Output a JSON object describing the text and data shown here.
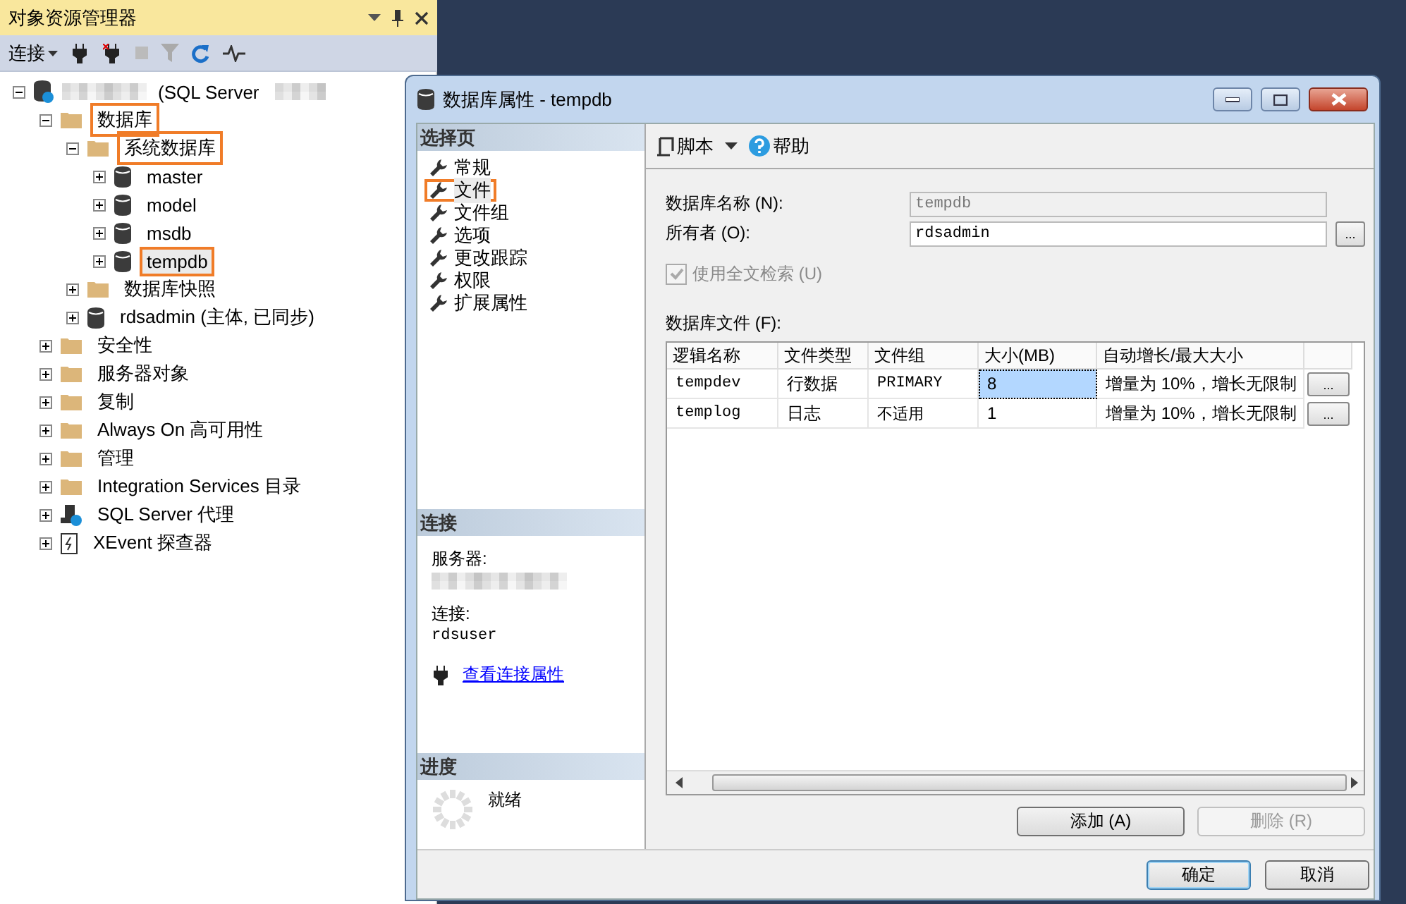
{
  "explorer": {
    "title": "对象资源管理器",
    "toolbar": {
      "connect": "连接"
    },
    "tree": [
      {
        "kind": "server",
        "label": "(SQL Server",
        "expanded": true,
        "selected": false,
        "annotated": false,
        "children": [
          {
            "kind": "folder",
            "label": "数据库",
            "expanded": true,
            "selected": false,
            "annotated": true,
            "children": [
              {
                "kind": "folder",
                "label": "系统数据库",
                "expanded": true,
                "selected": false,
                "annotated": true,
                "children": [
                  {
                    "kind": "database",
                    "label": "master",
                    "expanded": false,
                    "selected": false,
                    "annotated": false
                  },
                  {
                    "kind": "database",
                    "label": "model",
                    "expanded": false,
                    "selected": false,
                    "annotated": false
                  },
                  {
                    "kind": "database",
                    "label": "msdb",
                    "expanded": false,
                    "selected": false,
                    "annotated": false
                  },
                  {
                    "kind": "database",
                    "label": "tempdb",
                    "expanded": false,
                    "selected": true,
                    "annotated": true
                  }
                ]
              },
              {
                "kind": "folder",
                "label": "数据库快照",
                "expanded": false,
                "selected": false,
                "annotated": false
              },
              {
                "kind": "database",
                "label": "rdsadmin (主体, 已同步)",
                "expanded": false,
                "selected": false,
                "annotated": false
              }
            ]
          },
          {
            "kind": "folder",
            "label": "安全性",
            "expanded": false,
            "selected": false,
            "annotated": false
          },
          {
            "kind": "folder",
            "label": "服务器对象",
            "expanded": false,
            "selected": false,
            "annotated": false
          },
          {
            "kind": "folder",
            "label": "复制",
            "expanded": false,
            "selected": false,
            "annotated": false
          },
          {
            "kind": "folder",
            "label": "Always On 高可用性",
            "expanded": false,
            "selected": false,
            "annotated": false
          },
          {
            "kind": "folder",
            "label": "管理",
            "expanded": false,
            "selected": false,
            "annotated": false
          },
          {
            "kind": "folder",
            "label": "Integration Services 目录",
            "expanded": false,
            "selected": false,
            "annotated": false
          },
          {
            "kind": "agent",
            "label": "SQL Server 代理",
            "expanded": false,
            "selected": false,
            "annotated": false
          },
          {
            "kind": "xevent",
            "label": "XEvent 探查器",
            "expanded": false,
            "selected": false,
            "annotated": false
          }
        ]
      }
    ]
  },
  "dialog": {
    "title": "数据库属性 - tempdb",
    "select_pages": {
      "header": "选择页",
      "pages": [
        {
          "label": "常规",
          "selected": false,
          "annotated": false
        },
        {
          "label": "文件",
          "selected": true,
          "annotated": true
        },
        {
          "label": "文件组",
          "selected": false,
          "annotated": false
        },
        {
          "label": "选项",
          "selected": false,
          "annotated": false
        },
        {
          "label": "更改跟踪",
          "selected": false,
          "annotated": false
        },
        {
          "label": "权限",
          "selected": false,
          "annotated": false
        },
        {
          "label": "扩展属性",
          "selected": false,
          "annotated": false
        }
      ]
    },
    "connection": {
      "header": "连接",
      "server_label": "服务器:",
      "connection_label": "连接:",
      "connection_value": "rdsuser",
      "link": "查看连接属性"
    },
    "progress": {
      "header": "进度",
      "status": "就绪"
    },
    "toolbar": {
      "script": "脚本",
      "help": "帮助"
    },
    "name_field": {
      "label": "数据库名称 (N):",
      "value": "tempdb",
      "disabled": true
    },
    "owner_field": {
      "label": "所有者 (O):",
      "value": "rdsadmin",
      "disabled": false,
      "button": "..."
    },
    "fulltext": {
      "label": "使用全文检索 (U)",
      "checked": true,
      "disabled": true
    },
    "files_label": "数据库文件 (F):",
    "table": {
      "columns": [
        "逻辑名称",
        "文件类型",
        "文件组",
        "大小(MB)",
        "自动增长/最大大小"
      ],
      "rows": [
        {
          "cells": [
            {
              "text": "tempdev",
              "selected": false
            },
            {
              "text": "行数据",
              "selected": false
            },
            {
              "text": "PRIMARY",
              "selected": false
            },
            {
              "text": "8",
              "selected": true
            },
            {
              "text": "增量为 10%，增长无限制",
              "selected": false
            }
          ],
          "button": "..."
        },
        {
          "cells": [
            {
              "text": "templog",
              "selected": false
            },
            {
              "text": "日志",
              "selected": false
            },
            {
              "text": "不适用",
              "selected": false
            },
            {
              "text": "1",
              "selected": false
            },
            {
              "text": "增量为 10%，增长无限制",
              "selected": false
            }
          ],
          "button": "..."
        }
      ]
    },
    "file_buttons": [
      {
        "label": "添加 (A)",
        "disabled": false
      },
      {
        "label": "删除 (R)",
        "disabled": true
      }
    ],
    "buttons": [
      {
        "label": "确定",
        "default": true
      },
      {
        "label": "取消",
        "default": false
      }
    ]
  }
}
